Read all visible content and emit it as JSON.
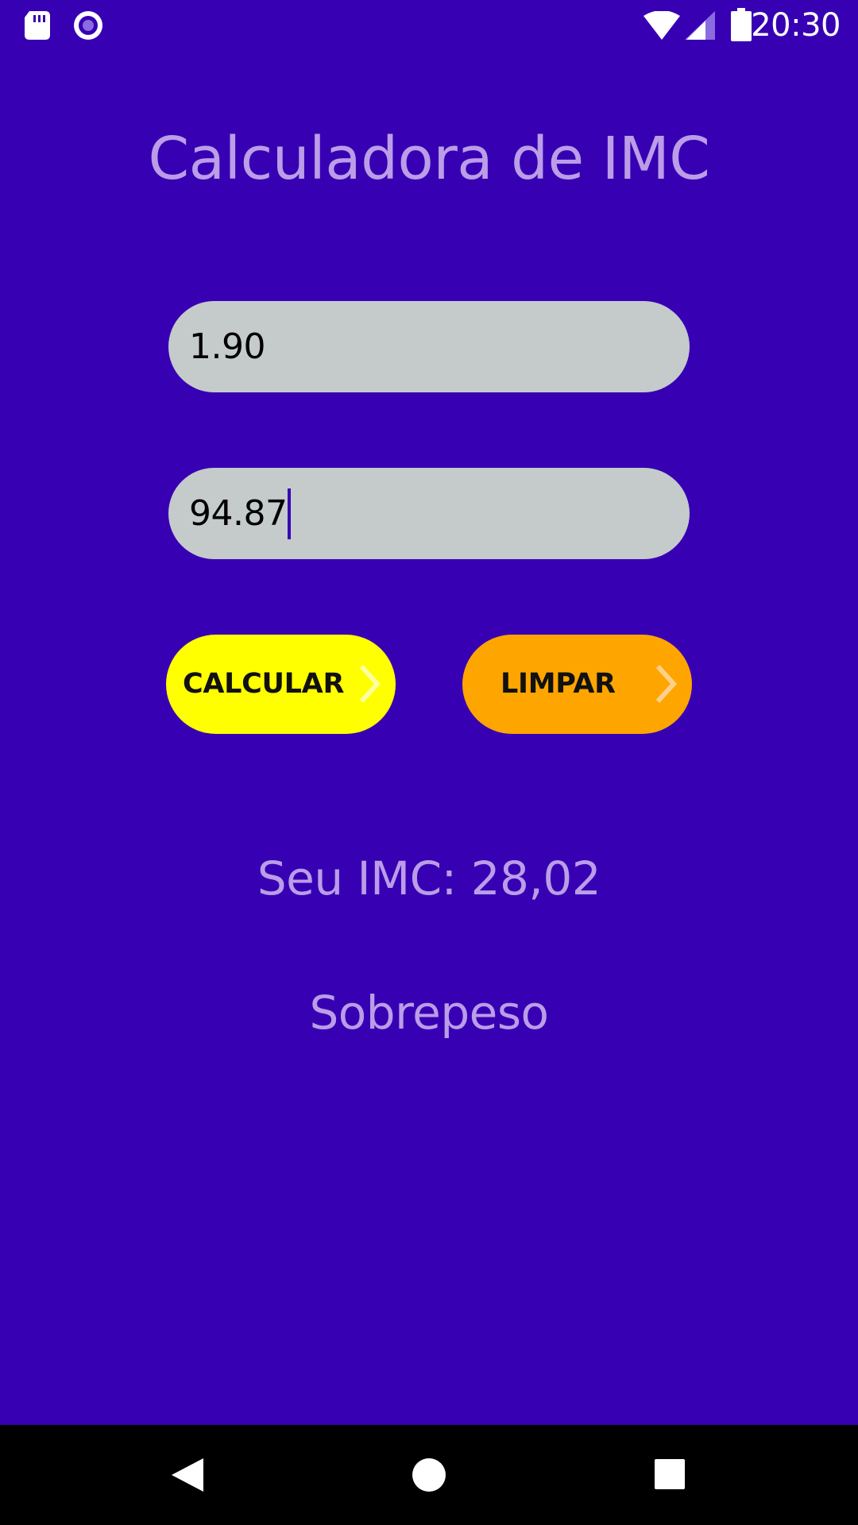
{
  "status_bar": {
    "time": "20:30",
    "icons": [
      "sd-card-icon",
      "screen-record-icon",
      "wifi-icon",
      "signal-icon",
      "battery-icon"
    ]
  },
  "app": {
    "title": "Calculadora de IMC"
  },
  "inputs": {
    "height_value": "1.90",
    "weight_value": "94.87"
  },
  "buttons": {
    "calculate_label": "CALCULAR",
    "clear_label": "LIMPAR"
  },
  "result": {
    "imc_text": "Seu IMC: 28,02",
    "classification": "Sobrepeso"
  },
  "nav_bar": {
    "icons": [
      "back-icon",
      "home-icon",
      "recents-icon"
    ]
  },
  "colors": {
    "background": "#3700B3",
    "title_text": "#BB9DE8",
    "input_background": "#C5CACB",
    "calculate_button": "#FFFF00",
    "clear_button": "#FFA500",
    "nav_bar": "#000000"
  }
}
